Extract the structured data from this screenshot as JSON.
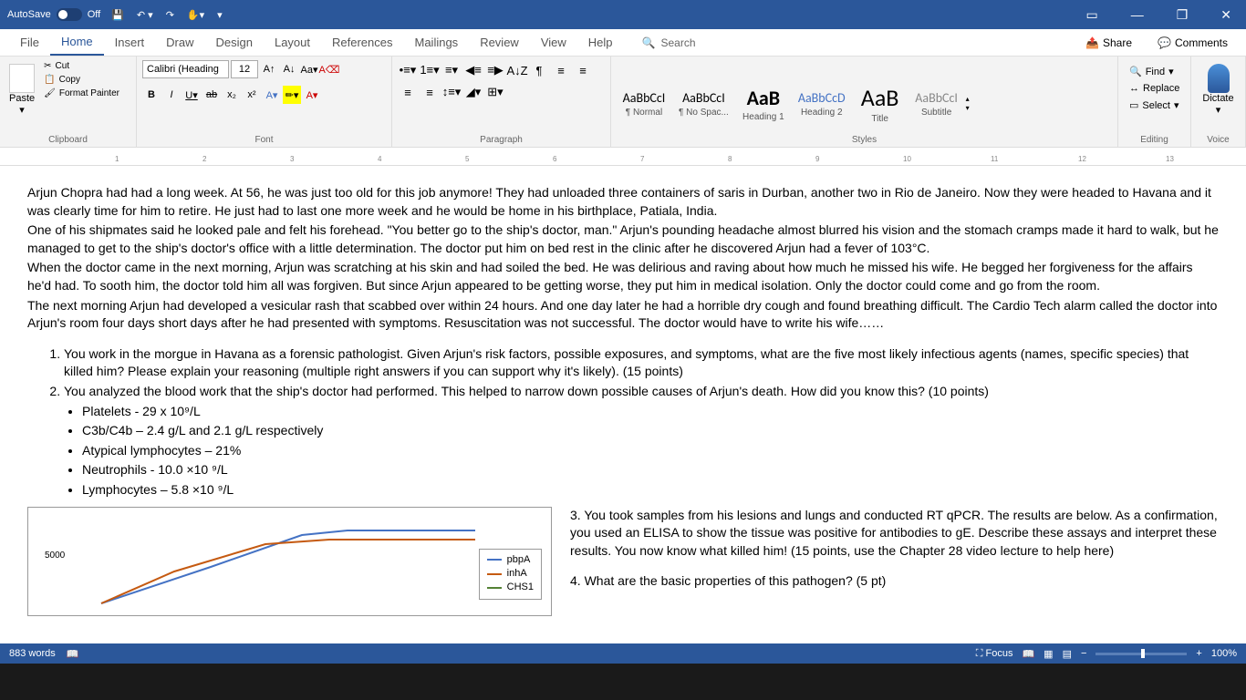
{
  "titlebar": {
    "autosave_label": "AutoSave",
    "autosave_state": "Off"
  },
  "tabs": {
    "file": "File",
    "home": "Home",
    "insert": "Insert",
    "draw": "Draw",
    "design": "Design",
    "layout": "Layout",
    "references": "References",
    "mailings": "Mailings",
    "review": "Review",
    "view": "View",
    "help": "Help"
  },
  "search_placeholder": "Search",
  "share_label": "Share",
  "comments_label": "Comments",
  "clipboard": {
    "paste": "Paste",
    "cut": "Cut",
    "copy": "Copy",
    "format_painter": "Format Painter",
    "group_label": "Clipboard"
  },
  "font": {
    "name": "Calibri (Heading",
    "size": "12",
    "group_label": "Font"
  },
  "paragraph": {
    "group_label": "Paragraph"
  },
  "styles": {
    "items": [
      {
        "preview": "AaBbCcI",
        "name": "¶ Normal",
        "css": "font-size:14px"
      },
      {
        "preview": "AaBbCcI",
        "name": "¶ No Spac...",
        "css": "font-size:14px"
      },
      {
        "preview": "AaB",
        "name": "Heading 1",
        "css": "font-size:22px;font-weight:bold"
      },
      {
        "preview": "AaBbCcD",
        "name": "Heading 2",
        "css": "font-size:14px;color:#4472c4"
      },
      {
        "preview": "AaB",
        "name": "Title",
        "css": "font-size:26px"
      },
      {
        "preview": "AaBbCcI",
        "name": "Subtitle",
        "css": "font-size:14px;color:#888"
      }
    ],
    "group_label": "Styles"
  },
  "editing": {
    "find": "Find",
    "replace": "Replace",
    "select": "Select",
    "group_label": "Editing"
  },
  "voice": {
    "dictate": "Dictate",
    "group_label": "Voice"
  },
  "document": {
    "p1": "Arjun Chopra had had a long week.  At 56, he was just too old for this job anymore!  They had unloaded three containers of saris in Durban, another two in Rio de Janeiro.  Now they were headed to Havana and it was clearly time for him to retire.  He just had to last one more week and he would be home in his birthplace, Patiala, India.",
    "p2": "One of his shipmates said he looked pale and felt his forehead.  \"You better go to the ship's doctor, man.\"   Arjun's pounding headache almost blurred his vision and the stomach cramps made it hard to walk, but he managed to get to the ship's doctor's office with a little determination.    The doctor put him on bed rest in the clinic after he discovered Arjun had a fever of 103°C.",
    "p3": "When the doctor came in the next morning, Arjun was scratching at his skin and had soiled the bed.  He was delirious and raving about how much he missed his wife.  He begged her forgiveness for the affairs he'd had.  To sooth him, the doctor told him all was forgiven.  But since Arjun appeared to be getting worse, they put him in medical isolation.  Only the doctor could come and go from the room.",
    "p4": "The next morning Arjun had developed a vesicular rash that scabbed over within 24 hours.  And one day later he had a horrible dry cough and found breathing difficult.  The Cardio Tech alarm called the doctor into Arjun's room four days short days after he had presented with symptoms.  Resuscitation was not successful.  The doctor would have to write his wife……",
    "q1": "You work in the morgue in Havana as a forensic pathologist.  Given Arjun's risk factors, possible exposures, and symptoms, what are the five most likely infectious agents (names, specific species) that killed him?  Please explain your reasoning (multiple right answers if you can support why it's likely). (15 points)",
    "q2": "You analyzed the blood work that the ship's doctor had performed.  This helped to narrow down possible causes of Arjun's death.  How did you know this? (10 points)",
    "b1": "Platelets - 29 x 10⁹/L",
    "b2": "C3b/C4b – 2.4 g/L and 2.1 g/L respectively",
    "b3": "Atypical lymphocytes – 21%",
    "b4": "Neutrophils - 10.0 ×10 ⁹/L",
    "b5": "Lymphocytes – 5.8 ×10 ⁹/L",
    "q3": "3. You took samples from his lesions and lungs and conducted RT qPCR.  The results are below.  As a confirmation, you used an ELISA to show the tissue was positive for antibodies to gE.  Describe these assays and interpret these results.  You now know what killed him! (15 points, use the Chapter 28 video lecture to help here)",
    "q4": "4. What are the basic properties of this pathogen? (5 pt)"
  },
  "chart_data": {
    "type": "line",
    "y_tick": "5000",
    "series": [
      {
        "name": "pbpA",
        "color": "#4472c4"
      },
      {
        "name": "inhA",
        "color": "#c55a11"
      },
      {
        "name": "CHS1",
        "color": "#548235"
      }
    ]
  },
  "statusbar": {
    "words": "883 words",
    "focus": "Focus",
    "zoom": "100%"
  }
}
